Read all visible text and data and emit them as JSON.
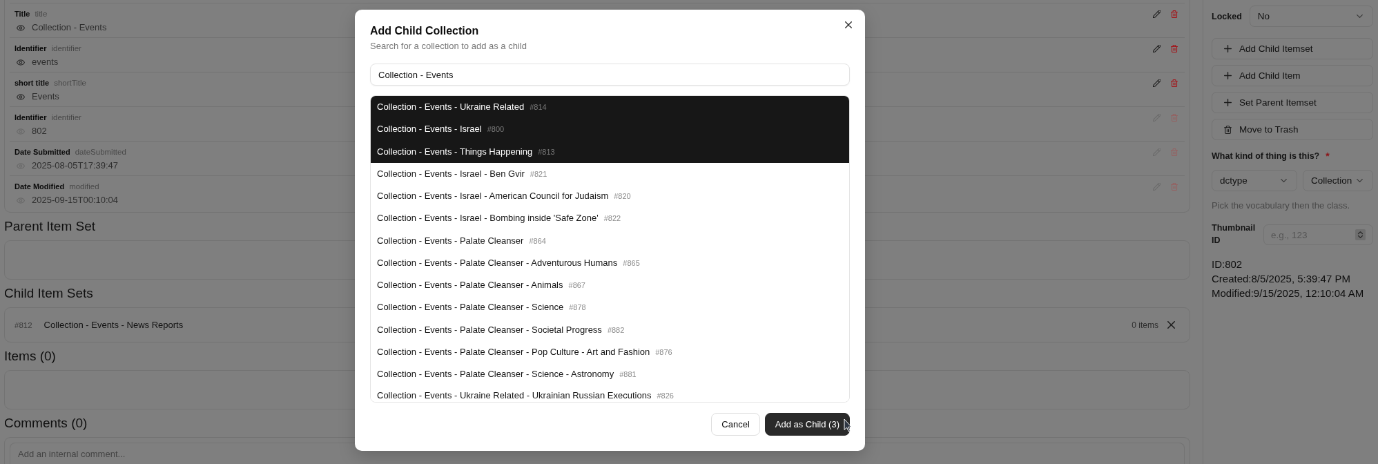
{
  "properties": [
    {
      "label": "Title",
      "term": "title",
      "value": "Collection - Events",
      "disabled": false
    },
    {
      "label": "Identifier",
      "term": "identifier",
      "value": "events",
      "disabled": false
    },
    {
      "label": "short title",
      "term": "shortTitle",
      "value": "Events",
      "disabled": false
    },
    {
      "label": "Identifier",
      "term": "identifier",
      "value": "802",
      "disabled": true
    },
    {
      "label": "Date Submitted",
      "term": "dateSubmitted",
      "value": "2025-08-05T17:39:47",
      "disabled": true
    },
    {
      "label": "Date Modified",
      "term": "modified",
      "value": "2025-09-15T00:10:04",
      "disabled": true
    }
  ],
  "sections": [
    {
      "kind": "empty",
      "heading": "Parent Item Set"
    },
    {
      "kind": "list",
      "heading": "Child Item Sets",
      "rows": [
        {
          "id": "#812",
          "title": "Collection - Events - News Reports",
          "count": "0 items"
        }
      ]
    },
    {
      "kind": "empty",
      "heading": "Items (0)"
    },
    {
      "kind": "comment",
      "heading": "Comments (0)",
      "placeholder": "Add an internal comment..."
    }
  ],
  "sidebar": {
    "locked": {
      "label": "Locked",
      "value": "No"
    },
    "actions": [
      {
        "kind": "add",
        "label": "Add Child Itemset"
      },
      {
        "kind": "add",
        "label": "Add Child Item"
      },
      {
        "kind": "add",
        "label": "Set Parent Itemset"
      },
      {
        "kind": "trash",
        "label": "Move to Trash"
      }
    ],
    "type": {
      "label": "What kind of thing is this?",
      "required_mark": "*",
      "vocabulary": "dctype",
      "class": "Collection",
      "hint": "Pick the vocabulary then the class."
    },
    "thumbnail": {
      "label": "Thumbnail ID",
      "placeholder": "e.g., 123"
    },
    "meta": [
      "ID:802",
      "Created:8/5/2025, 5:39:47 PM",
      "Modified:9/15/2025, 12:10:04 AM"
    ]
  },
  "dialog": {
    "title": "Add Child Collection",
    "subtitle": "Search for a collection to add as a child",
    "search": {
      "value": "Collection - Events"
    },
    "results": [
      {
        "title": "Collection - Events - Ukraine Related",
        "id": "#814",
        "selected": true
      },
      {
        "title": "Collection - Events - Israel",
        "id": "#800",
        "selected": true
      },
      {
        "title": "Collection - Events - Things Happening",
        "id": "#813",
        "selected": true
      },
      {
        "title": "Collection - Events - Israel - Ben Gvir",
        "id": "#821",
        "selected": false
      },
      {
        "title": "Collection - Events - Israel - American Council for Judaism",
        "id": "#820",
        "selected": false
      },
      {
        "title": "Collection - Events - Israel - Bombing inside 'Safe Zone'",
        "id": "#822",
        "selected": false
      },
      {
        "title": "Collection - Events - Palate Cleanser",
        "id": "#864",
        "selected": false
      },
      {
        "title": "Collection - Events - Palate Cleanser - Adventurous Humans",
        "id": "#865",
        "selected": false
      },
      {
        "title": "Collection - Events - Palate Cleanser - Animals",
        "id": "#867",
        "selected": false
      },
      {
        "title": "Collection - Events - Palate Cleanser - Science",
        "id": "#878",
        "selected": false
      },
      {
        "title": "Collection - Events - Palate Cleanser - Societal Progress",
        "id": "#882",
        "selected": false
      },
      {
        "title": "Collection - Events - Palate Cleanser - Pop Culture - Art and Fashion",
        "id": "#876",
        "selected": false
      },
      {
        "title": "Collection - Events - Palate Cleanser - Science - Astronomy",
        "id": "#881",
        "selected": false
      },
      {
        "title": "Collection - Events - Ukraine Related - Ukrainian Russian Executions",
        "id": "#826",
        "selected": false
      }
    ],
    "buttons": [
      {
        "kind": "secondary",
        "label": "Cancel"
      },
      {
        "kind": "primary",
        "label": "Add as Child (3)"
      }
    ]
  }
}
